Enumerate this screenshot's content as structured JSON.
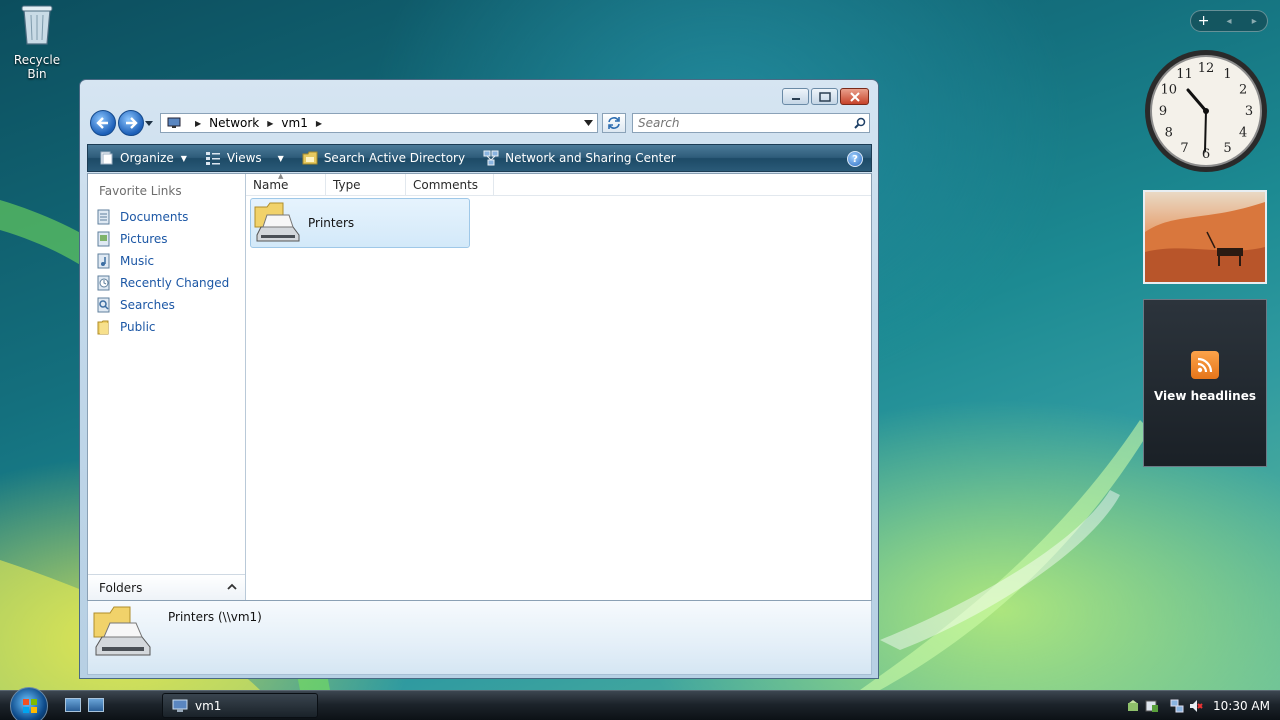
{
  "desktop": {
    "icons": [
      {
        "label": "Recycle Bin",
        "icon": "recycle-bin-icon"
      }
    ]
  },
  "sidebar": {
    "gadget_bar": {
      "add": "+",
      "prev": "◂",
      "next": "▸"
    },
    "clock": {
      "numerals": [
        "12",
        "1",
        "2",
        "3",
        "4",
        "5",
        "6",
        "7",
        "8",
        "9",
        "10",
        "11"
      ]
    },
    "feed_gadget": {
      "label": "View headlines",
      "icon": "rss-icon"
    }
  },
  "window": {
    "title_buttons": [
      "minimize",
      "maximize",
      "close"
    ],
    "address": {
      "crumbs": [
        "Network",
        "vm1"
      ]
    },
    "search": {
      "placeholder": "Search"
    },
    "command_bar": {
      "items": [
        {
          "label": "Organize",
          "icon": "organize-icon",
          "dropdown": true
        },
        {
          "label": "Views",
          "icon": "views-icon",
          "dropdown": true
        },
        {
          "label": "Search Active Directory",
          "icon": "directory-icon",
          "dropdown": false
        },
        {
          "label": "Network and Sharing Center",
          "icon": "network-center-icon",
          "dropdown": false
        }
      ],
      "help": "?"
    },
    "nav_pane": {
      "title": "Favorite Links",
      "links": [
        {
          "label": "Documents",
          "icon": "documents-icon"
        },
        {
          "label": "Pictures",
          "icon": "pictures-icon"
        },
        {
          "label": "Music",
          "icon": "music-icon"
        },
        {
          "label": "Recently Changed",
          "icon": "recently-changed-icon"
        },
        {
          "label": "Searches",
          "icon": "searches-icon"
        },
        {
          "label": "Public",
          "icon": "public-folder-icon"
        }
      ],
      "folders_label": "Folders"
    },
    "columns": [
      "Name",
      "Type",
      "Comments"
    ],
    "items": [
      {
        "label": "Printers",
        "icon": "printers-folder-icon",
        "selected": true
      }
    ],
    "details_pane": {
      "name": "Printers (\\\\vm1)"
    }
  },
  "taskbar": {
    "tasks": [
      {
        "label": "vm1",
        "icon": "network-computer-icon"
      }
    ],
    "tray": {
      "time": "10:30 AM"
    }
  },
  "colors": {
    "link": "#1c57a5",
    "accent": "#1d4a66",
    "selection": "#d3e9f9"
  }
}
